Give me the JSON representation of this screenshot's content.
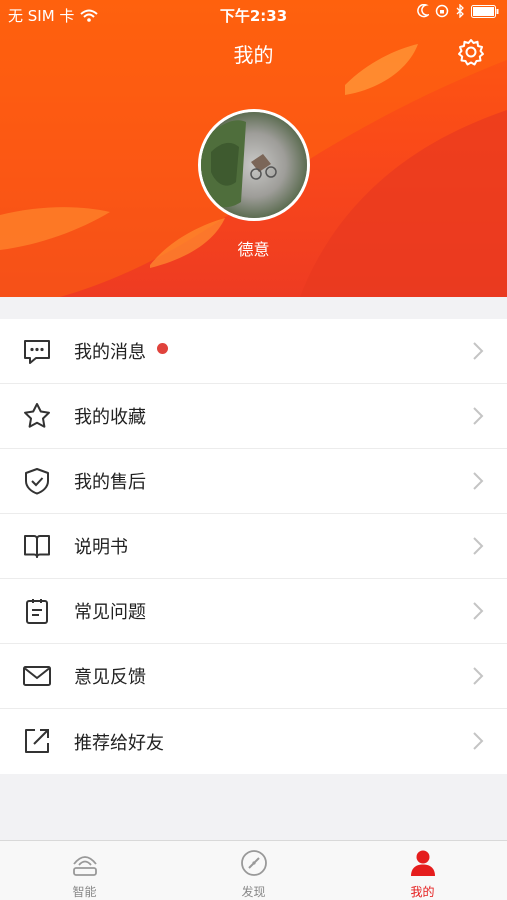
{
  "status_bar": {
    "carrier": "无 SIM 卡",
    "time": "下午2:33"
  },
  "header": {
    "title": "我的",
    "username": "德意"
  },
  "menu": {
    "items": [
      {
        "label": "我的消息",
        "icon": "message-icon",
        "badge": true
      },
      {
        "label": "我的收藏",
        "icon": "star-icon"
      },
      {
        "label": "我的售后",
        "icon": "shield-check-icon"
      },
      {
        "label": "说明书",
        "icon": "book-icon"
      },
      {
        "label": "常见问题",
        "icon": "clipboard-icon"
      },
      {
        "label": "意见反馈",
        "icon": "mail-icon"
      },
      {
        "label": "推荐给好友",
        "icon": "share-icon"
      }
    ]
  },
  "tabbar": {
    "tabs": [
      {
        "label": "智能",
        "icon": "smart-device-icon",
        "active": false
      },
      {
        "label": "发现",
        "icon": "compass-icon",
        "active": false
      },
      {
        "label": "我的",
        "icon": "person-icon",
        "active": true
      }
    ]
  },
  "colors": {
    "header_orange": "#ff5a0e",
    "accent_red": "#e51d1d",
    "badge_red": "#e0423c",
    "background": "#f2f2f4"
  }
}
